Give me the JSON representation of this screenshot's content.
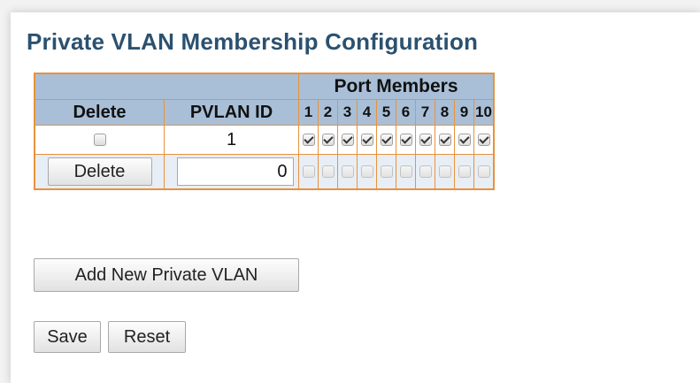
{
  "page_title": "Private VLAN Membership Configuration",
  "table": {
    "port_members_header": "Port Members",
    "delete_header": "Delete",
    "pvlan_id_header": "PVLAN ID",
    "ports": [
      "1",
      "2",
      "3",
      "4",
      "5",
      "6",
      "7",
      "8",
      "9",
      "10"
    ]
  },
  "rows": [
    {
      "delete_checked": false,
      "pvlan_id": "1",
      "members": [
        true,
        true,
        true,
        true,
        true,
        true,
        true,
        true,
        true,
        true
      ]
    },
    {
      "delete_button": "Delete",
      "pvlan_id_input": "0",
      "members": [
        false,
        false,
        false,
        false,
        false,
        false,
        false,
        false,
        false,
        false
      ]
    }
  ],
  "buttons": {
    "add_new": "Add New Private VLAN",
    "save": "Save",
    "reset": "Reset"
  }
}
